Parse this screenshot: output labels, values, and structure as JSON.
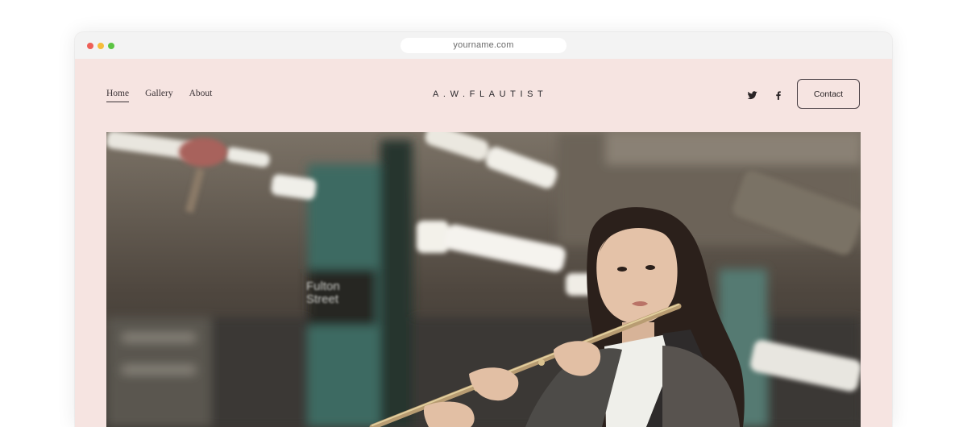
{
  "browser": {
    "url": "yourname.com"
  },
  "nav": {
    "items": [
      {
        "label": "Home",
        "active": true
      },
      {
        "label": "Gallery",
        "active": false
      },
      {
        "label": "About",
        "active": false
      }
    ]
  },
  "brand": {
    "title": "A.W.FLAUTIST"
  },
  "social": {
    "icons": [
      "twitter-icon",
      "facebook-icon"
    ]
  },
  "header": {
    "contact_label": "Contact"
  },
  "hero": {
    "sign_text": [
      "Fulton",
      "Street"
    ]
  },
  "colors": {
    "page_background": "#f6e4e1",
    "text": "#2c2a2e"
  }
}
